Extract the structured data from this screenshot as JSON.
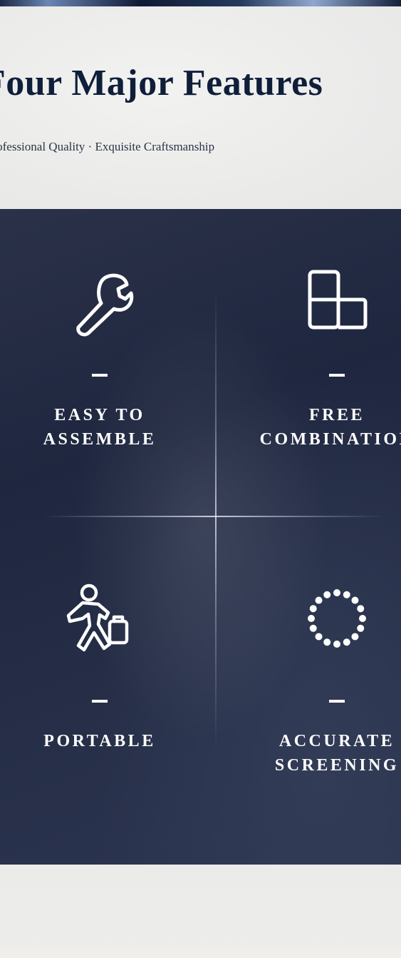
{
  "header": {
    "title": "Four Major Features",
    "subtitle": "Professional Quality · Exquisite Craftsmanship"
  },
  "features": [
    {
      "label": "EASY TO\nASSEMBLE",
      "icon": "wrench-icon"
    },
    {
      "label": "FREE\nCOMBINATION",
      "icon": "grid-blocks-icon"
    },
    {
      "label": "PORTABLE",
      "icon": "person-carrying-case-icon"
    },
    {
      "label": "ACCURATE\nSCREENING",
      "icon": "dotted-circle-icon"
    }
  ],
  "colors": {
    "title": "#0f1f3a",
    "panel": "#232b43",
    "text_light": "#ffffff"
  }
}
